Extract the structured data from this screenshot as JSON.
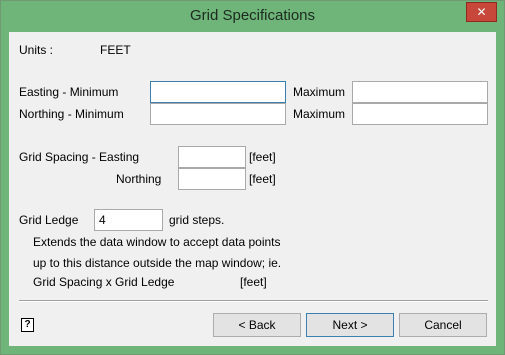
{
  "window": {
    "title": "Grid Specifications",
    "close_glyph": "✕"
  },
  "units": {
    "label": "Units :",
    "value": "FEET"
  },
  "easting": {
    "min_label": "Easting  - Minimum",
    "min_value": "",
    "max_label": "Maximum",
    "max_value": ""
  },
  "northing": {
    "min_label": "Northing - Minimum",
    "min_value": "",
    "max_label": "Maximum",
    "max_value": ""
  },
  "grid_spacing": {
    "easting_label": "Grid Spacing - Easting",
    "easting_value": "",
    "northing_label": "Northing",
    "northing_value": "",
    "unit": "[feet]"
  },
  "grid_ledge": {
    "label": "Grid Ledge",
    "value": "4",
    "suffix": "grid steps.",
    "desc_line1": "Extends the data window to accept data points",
    "desc_line2": "up to this distance outside the map window; ie.",
    "formula": "Grid Spacing x Grid Ledge",
    "formula_unit": "[feet]"
  },
  "buttons": {
    "back": "< Back",
    "next": "Next >",
    "cancel": "Cancel"
  },
  "help": {
    "glyph": "?"
  },
  "icons": {
    "help": "help-icon",
    "close": "close-icon"
  },
  "colors": {
    "titlebar": "#6fb57a",
    "close": "#c7473b",
    "focus": "#3c7fb1"
  }
}
